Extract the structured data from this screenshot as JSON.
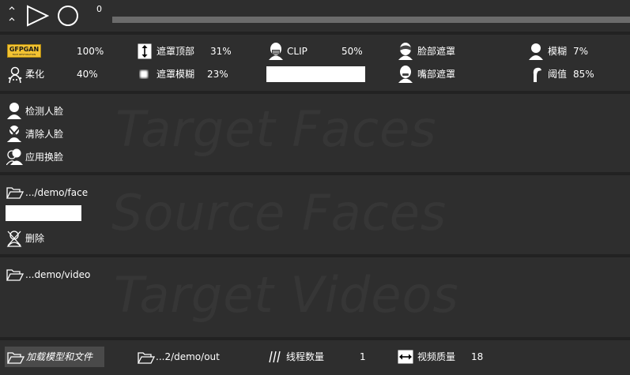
{
  "colors": {
    "background": "#222222",
    "panel": "#2e2e2e",
    "watermark": "#363636",
    "progress_track": "#6b6b6b",
    "load_button": "#4a4a4a",
    "gfpgan_logo": "#f2c232"
  },
  "player": {
    "step_icon": "step-up-down-icon",
    "play_icon": "play-icon",
    "record_icon": "record-circle-icon",
    "frame_number": "0",
    "progress": 0
  },
  "parameters": {
    "gfpgan": {
      "logo_text": "GFPGAN",
      "logo_subtext": "FACE RESTORATION",
      "value": "100%"
    },
    "mask_top": {
      "label": "遮罩顶部",
      "value": "31%",
      "icon": "vertical-arrows-icon"
    },
    "clip": {
      "label": "CLIP",
      "value": "50%",
      "icon": "face-clip-icon"
    },
    "face_mask": {
      "label": "脸部遮罩",
      "icon": "face-mask-icon"
    },
    "blur": {
      "label": "模糊",
      "value": "7%",
      "icon": "person-blur-icon"
    },
    "soften": {
      "label": "柔化",
      "value": "40%",
      "icon": "soften-face-icon"
    },
    "mask_blur": {
      "label": "遮罩模糊",
      "value": "23%",
      "icon": "blur-square-icon"
    },
    "mouth_mask": {
      "label": "嘴部遮罩",
      "icon": "mouth-mask-icon"
    },
    "threshold": {
      "label": "阈值",
      "value": "85%",
      "icon": "threshold-icon"
    }
  },
  "target_faces": {
    "watermark": "Target Faces",
    "buttons": [
      {
        "label": "检测人脸",
        "icon": "person-detect-icon"
      },
      {
        "label": "清除人脸",
        "icon": "person-clear-icon"
      },
      {
        "label": "应用换脸",
        "icon": "person-swap-icon"
      }
    ]
  },
  "source_faces": {
    "watermark": "Source Faces",
    "folder_label": ".../demo/face",
    "folder_icon": "folder-open-icon",
    "delete_label": "删除",
    "delete_icon": "delete-person-icon"
  },
  "target_videos": {
    "watermark": "Target Videos",
    "folder_label": "...demo/video",
    "folder_icon": "folder-open-icon"
  },
  "bottom_bar": {
    "load_label": "加载模型和文件",
    "load_icon": "folder-open-icon",
    "output_label": "...2/demo/out",
    "output_icon": "folder-open-icon",
    "threads_label": "线程数量",
    "threads_value": "1",
    "threads_icon": "slashes-icon",
    "quality_label": "视频质量",
    "quality_value": "18",
    "quality_icon": "horizontal-arrows-icon"
  }
}
